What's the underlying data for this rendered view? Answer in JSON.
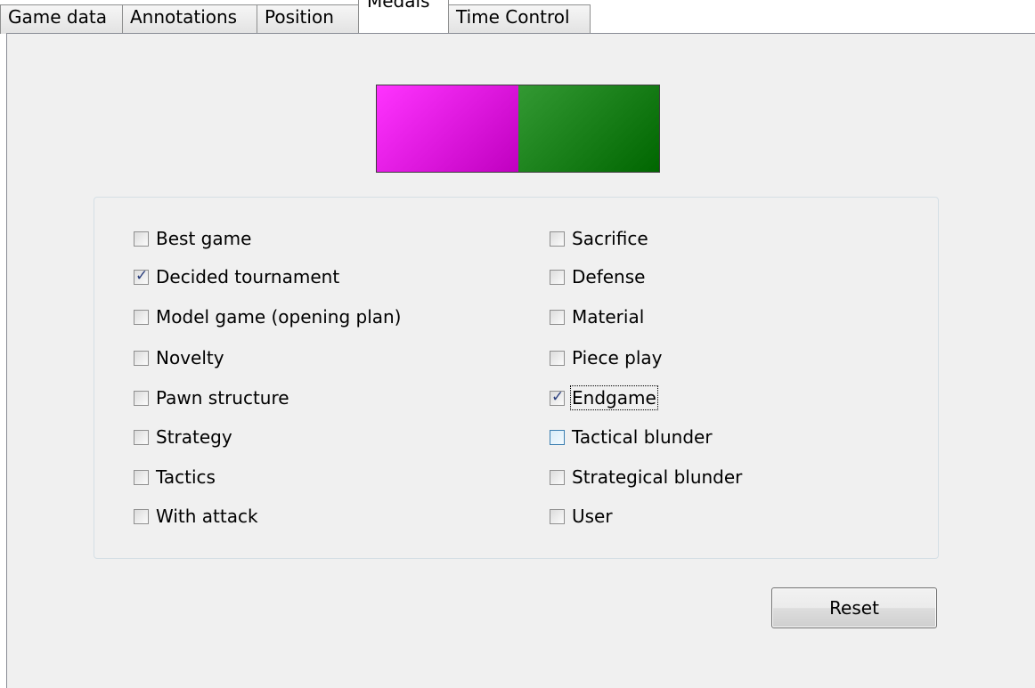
{
  "tabs": [
    {
      "label": "Game data",
      "active": false
    },
    {
      "label": "Annotations",
      "active": false
    },
    {
      "label": "Position",
      "active": false
    },
    {
      "label": "Medals",
      "active": true
    },
    {
      "label": "Time Control",
      "active": false
    }
  ],
  "medal_colors": {
    "left": "#ff33ff",
    "left_end": "#c000c0",
    "right": "#339933",
    "right_end": "#006600"
  },
  "medals": {
    "left_column": [
      {
        "label": "Best game",
        "checked": false
      },
      {
        "label": "Decided tournament",
        "checked": true
      },
      {
        "label": "Model game (opening plan)",
        "checked": false
      },
      {
        "label": "Novelty",
        "checked": false
      },
      {
        "label": "Pawn structure",
        "checked": false
      },
      {
        "label": "Strategy",
        "checked": false
      },
      {
        "label": "Tactics",
        "checked": false
      },
      {
        "label": "With attack",
        "checked": false
      }
    ],
    "right_column": [
      {
        "label": "Sacrifice",
        "checked": false
      },
      {
        "label": "Defense",
        "checked": false
      },
      {
        "label": "Material",
        "checked": false
      },
      {
        "label": "Piece play",
        "checked": false
      },
      {
        "label": "Endgame",
        "checked": true,
        "focused": true
      },
      {
        "label": "Tactical blunder",
        "checked": false,
        "hovered": true
      },
      {
        "label": "Strategical blunder",
        "checked": false
      },
      {
        "label": "User",
        "checked": false
      }
    ]
  },
  "reset_button": {
    "label": "Reset"
  }
}
